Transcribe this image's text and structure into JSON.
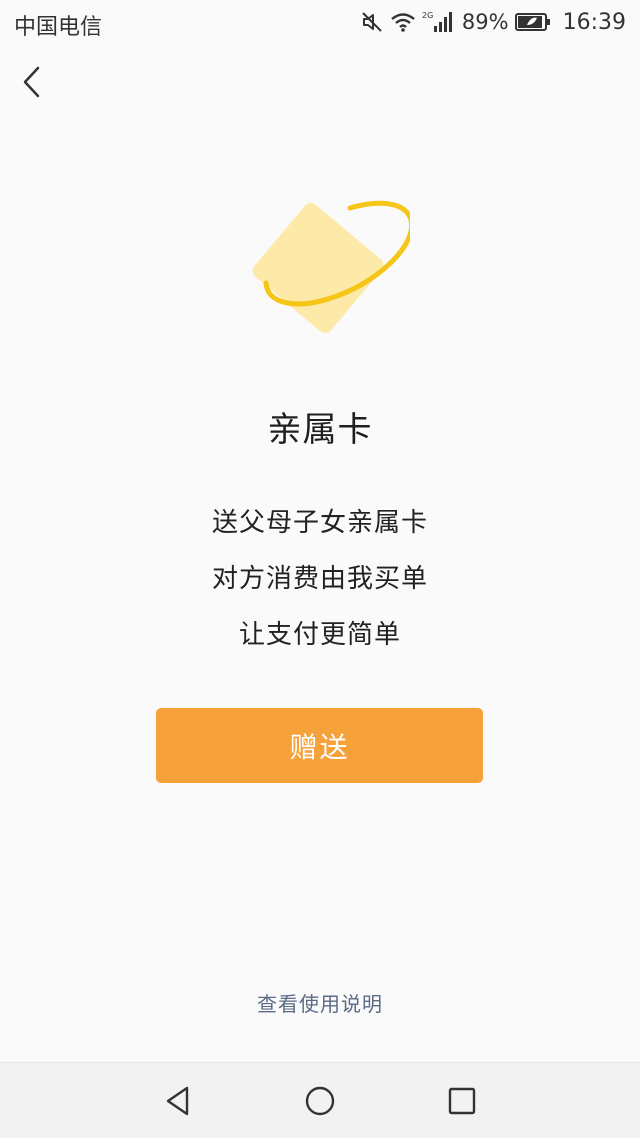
{
  "status_bar": {
    "carrier": "中国电信",
    "network": "2G",
    "battery": "89%",
    "time": "16:39"
  },
  "hero": {
    "icon": "family-card-icon",
    "colors": {
      "card": "#fde9a8",
      "ring": "#f5c518"
    }
  },
  "main": {
    "title": "亲属卡",
    "lines": [
      "送父母子女亲属卡",
      "对方消费由我买单",
      "让支付更简单"
    ],
    "gift_button": "赠送",
    "help_link": "查看使用说明"
  },
  "theme": {
    "accent": "#f7a13b",
    "link": "#5b6b86"
  }
}
